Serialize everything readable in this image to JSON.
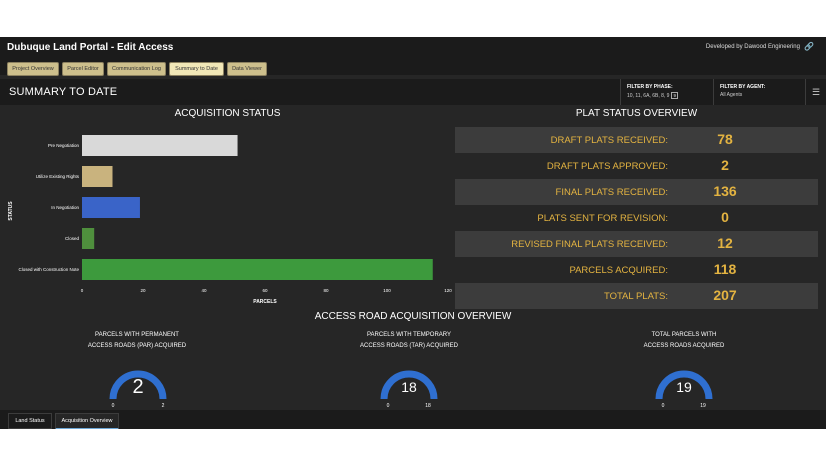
{
  "app": {
    "title": "Dubuque Land Portal - Edit Access",
    "developer": "Developed by Dawood Engineering"
  },
  "tabs": [
    "Project Overview",
    "Parcel Editor",
    "Communication Log",
    "Summary to Date",
    "Data Viewer"
  ],
  "active_tab": "Summary to Date",
  "summary": {
    "title": "SUMMARY TO DATE",
    "filter_phase": {
      "label": "FILTER BY PHASE:",
      "value": "10, 11, 6A, 6B, 8, 9",
      "badge": "9"
    },
    "filter_agent": {
      "label": "FILTER BY AGENT:",
      "value": "All Agents"
    }
  },
  "acquisition": {
    "title": "ACQUISITION STATUS"
  },
  "chart_data": {
    "type": "bar",
    "orientation": "horizontal",
    "categories": [
      "Pre Negotiation",
      "Utilize Existing Rights",
      "In Negotiation",
      "Closed",
      "Closed with Construction Note"
    ],
    "values": [
      51,
      10,
      19,
      4,
      115
    ],
    "colors": [
      "#d9d9d9",
      "#c9b37e",
      "#3a64c8",
      "#4f8f3d",
      "#3d9a3d"
    ],
    "xlabel": "PARCELS",
    "ylabel": "STATUS",
    "xlim": [
      0,
      120
    ],
    "xticks": [
      "0",
      "20",
      "40",
      "60",
      "80",
      "100",
      "120"
    ],
    "grid": false,
    "title": "ACQUISITION STATUS"
  },
  "plat_status": {
    "title": "PLAT STATUS OVERVIEW",
    "rows": [
      {
        "label": "DRAFT PLATS RECEIVED:",
        "value": "78"
      },
      {
        "label": "DRAFT PLATS APPROVED:",
        "value": "2"
      },
      {
        "label": "FINAL PLATS RECEIVED:",
        "value": "136"
      },
      {
        "label": "PLATS SENT FOR REVISION:",
        "value": "0"
      },
      {
        "label": "REVISED FINAL PLATS RECEIVED:",
        "value": "12"
      },
      {
        "label": "PARCELS ACQUIRED:",
        "value": "118"
      },
      {
        "label": "TOTAL PLATS:",
        "value": "207"
      }
    ],
    "value_color": "#e3b341"
  },
  "access_road": {
    "title": "ACCESS ROAD ACQUISITION OVERVIEW",
    "gauges": [
      {
        "line1": "PARCELS WITH PERMANENT",
        "line2": "ACCESS ROADS (PAR) ACQUIRED",
        "value": "2",
        "min": "0",
        "max": "2"
      },
      {
        "line1": "PARCELS WITH TEMPORARY",
        "line2": "ACCESS ROADS (TAR) ACQUIRED",
        "value": "18",
        "min": "0",
        "max": "18"
      },
      {
        "line1": "TOTAL PARCELS WITH",
        "line2": "ACCESS ROADS ACQUIRED",
        "value": "19",
        "min": "0",
        "max": "19"
      }
    ],
    "gauge_color": "#2f6fd0"
  },
  "bottom_tabs": [
    "Land Status",
    "Acquisition Overview"
  ],
  "active_bottom_tab": "Acquisition Overview"
}
